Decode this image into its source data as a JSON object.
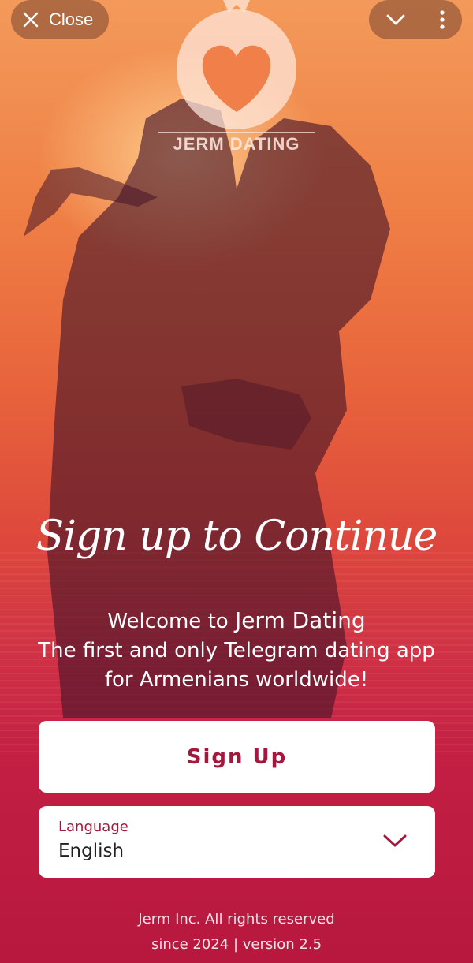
{
  "topbar": {
    "close_label": "Close",
    "close_icon": "x-icon",
    "collapse_icon": "chevron-down-icon",
    "menu_icon": "more-vertical-icon"
  },
  "logo": {
    "text": "JERM DATING",
    "icon": "pomegranate-heart-icon"
  },
  "hero": {
    "headline": "Sign up to Continue",
    "welcome_prefix": "Welcome to ",
    "welcome_brand": "Jerm Dating",
    "tagline": "The first and only Telegram dating app for Armenians worldwide!"
  },
  "signup": {
    "label": "Sign Up"
  },
  "language": {
    "label": "Language",
    "value": "English"
  },
  "footer": {
    "line1": "Jerm Inc. All rights reserved",
    "line2": "since 2024 | version 2.5"
  },
  "colors": {
    "accent": "#a3193d",
    "background_bottom": "#b8183e",
    "sunset_top": "#f39a5a"
  }
}
